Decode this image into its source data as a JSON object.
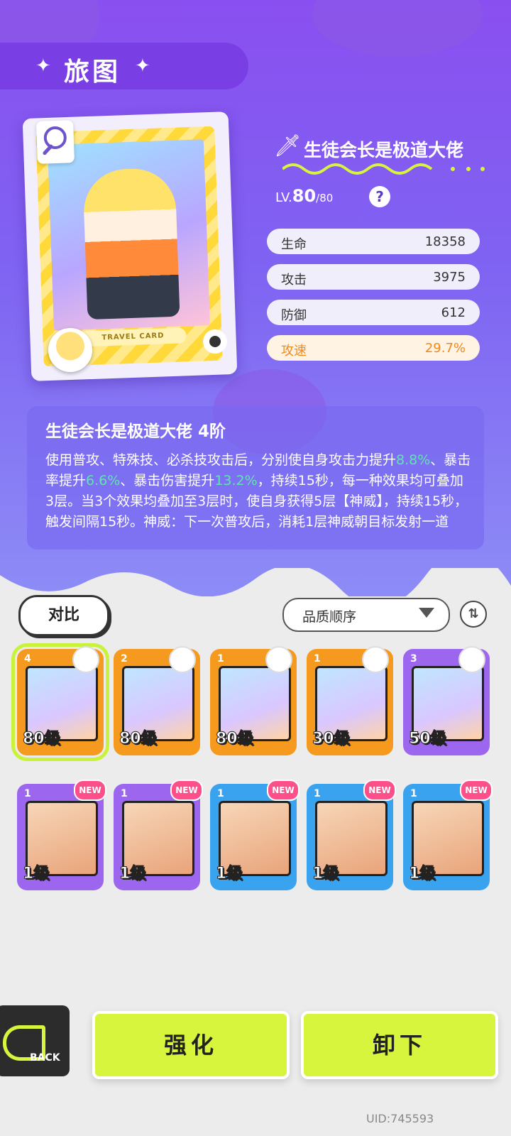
{
  "header": {
    "title": "旅图"
  },
  "card": {
    "label": "TRAVEL CARD",
    "name": "生徒会长是极道大佬",
    "level_prefix": "LV.",
    "level": "80",
    "level_max": "/80"
  },
  "stats": [
    {
      "label": "生命",
      "value": "18358"
    },
    {
      "label": "攻击",
      "value": "3975"
    },
    {
      "label": "防御",
      "value": "612"
    },
    {
      "label": "攻速",
      "value": "29.7%"
    }
  ],
  "skill": {
    "title": "生徒会长是极道大佬 4阶",
    "text_parts": [
      "使用普攻、特殊技、必杀技攻击后，分别使自身攻击力提升",
      "8.8%",
      "、暴击率提升",
      "6.6%",
      "、暴击伤害提升",
      "13.2%",
      "，持续15秒，每一种效果均可叠加3层。当3个效果均叠加至3层时，使自身获得5层【神威】，持续15秒，触发间隔15秒。神威：下一次普攻后，消耗1层神威朝目标发射一道"
    ]
  },
  "controls": {
    "compare_label": "对比",
    "sort_label": "品质顺序"
  },
  "inventory": [
    {
      "stars": "4",
      "level": "80级",
      "color": "#f59a1f",
      "new": false
    },
    {
      "stars": "2",
      "level": "80级",
      "color": "#f59a1f",
      "new": false
    },
    {
      "stars": "1",
      "level": "80级",
      "color": "#f59a1f",
      "new": false
    },
    {
      "stars": "1",
      "level": "30级",
      "color": "#f59a1f",
      "new": false
    },
    {
      "stars": "3",
      "level": "50级",
      "color": "#9c66ef",
      "new": false
    },
    {
      "stars": "1",
      "level": "1级",
      "color": "#9c66ef",
      "new": true
    },
    {
      "stars": "1",
      "level": "1级",
      "color": "#9c66ef",
      "new": true
    },
    {
      "stars": "1",
      "level": "1级",
      "color": "#3aa3ef",
      "new": true
    },
    {
      "stars": "1",
      "level": "1级",
      "color": "#3aa3ef",
      "new": true
    },
    {
      "stars": "1",
      "level": "1级",
      "color": "#3aa3ef",
      "new": true
    }
  ],
  "new_badge": "NEW",
  "bottom": {
    "back_label": "BACK",
    "enhance_label": "强化",
    "unequip_label": "卸下",
    "uid": "UID:745593"
  }
}
